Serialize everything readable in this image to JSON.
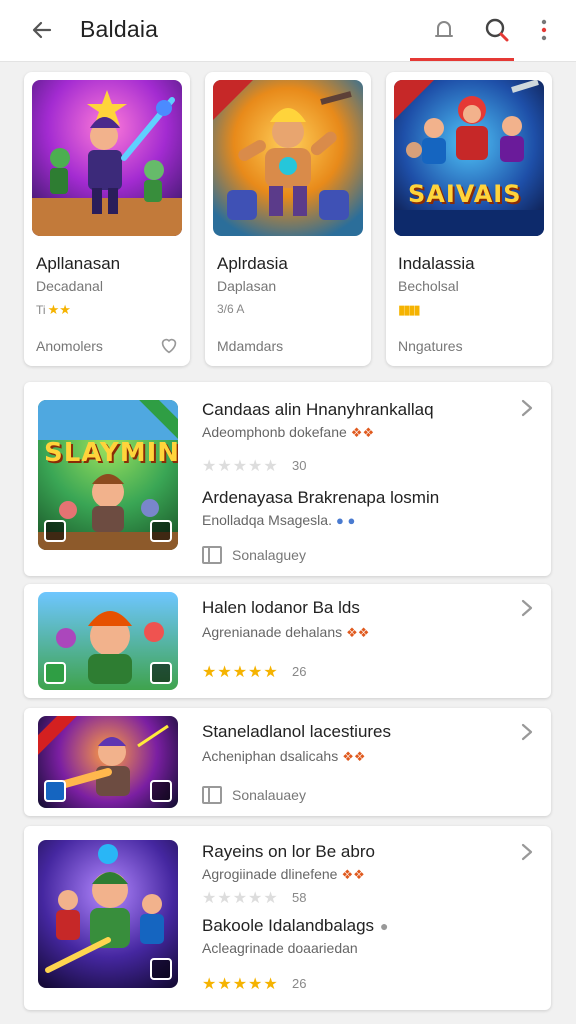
{
  "header": {
    "title": "Baldaia",
    "back_icon": "arrow-left-icon",
    "account_icon": "account-icon",
    "search_icon": "search-icon",
    "more_icon": "more-vert-icon",
    "accent_color": "#e53935"
  },
  "top_cards": [
    {
      "name": "Apllanasan",
      "sub": "Decadanal",
      "rating": "Ti",
      "footer": "Anomolers",
      "art": "hero-warrior"
    },
    {
      "name": "Aplrdasia",
      "sub": "Daplasan",
      "rating": "3/6 A",
      "footer": "Mdamdars",
      "art": "brawler"
    },
    {
      "name": "Indalassia",
      "sub": "Becholsal",
      "rating": "",
      "footer": "Nngatures",
      "art": "team-saivais",
      "art_title": "SAIVAIS"
    }
  ],
  "list_items": [
    {
      "art_title": "SLAYMINS",
      "entries": [
        {
          "title": "Candaas alin Hnanyhrankallaq",
          "sub": "Adeomphonb dokefane",
          "rating_value": "30"
        },
        {
          "title": "Ardenayasa Brakrenapa losmin",
          "sub": "Enolladqa Msagesla."
        }
      ],
      "footer": "Sonalaguey"
    },
    {
      "entries": [
        {
          "title": "Halen lodanor Ba lds",
          "sub": "Agrenianade dehalans",
          "rating_value": "26"
        }
      ]
    },
    {
      "entries": [
        {
          "title": "Staneladlanol lacestiures",
          "sub": "Acheniphan dsalicahs"
        }
      ],
      "footer": "Sonalauaey"
    },
    {
      "entries": [
        {
          "title": "Rayeins on lor Be abro",
          "sub": "Agrogiinade dlinefene",
          "rating_value": "58"
        },
        {
          "title": "Bakoole Idalandbalags",
          "sub": "Acleagrinade doaariedan",
          "rating_value": "26"
        }
      ]
    }
  ]
}
